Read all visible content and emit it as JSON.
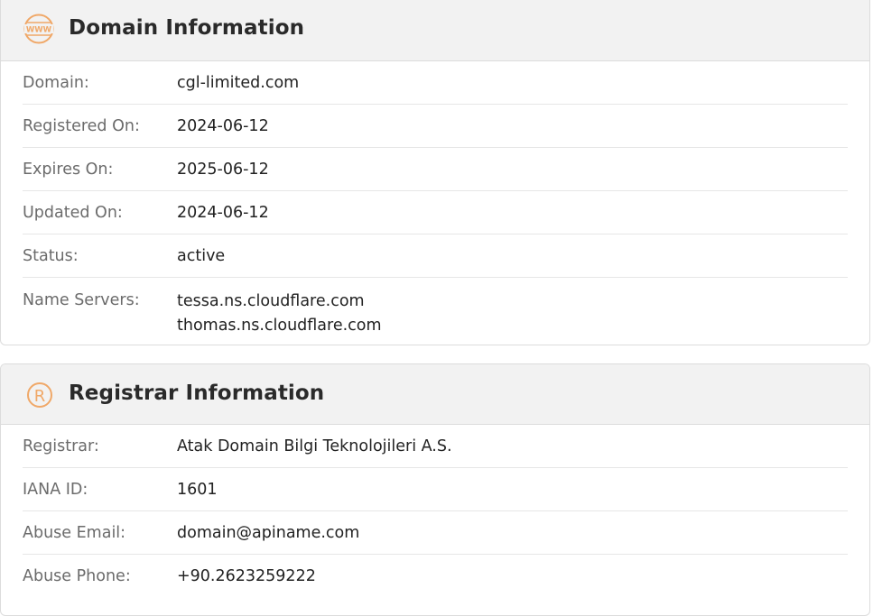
{
  "domain_section": {
    "title": "Domain Information",
    "icon": "www-icon",
    "accent": "#f0a868",
    "rows": [
      {
        "label": "Domain:",
        "value": "cgl-limited.com"
      },
      {
        "label": "Registered On:",
        "value": "2024-06-12"
      },
      {
        "label": "Expires On:",
        "value": "2025-06-12"
      },
      {
        "label": "Updated On:",
        "value": "2024-06-12"
      },
      {
        "label": "Status:",
        "value": "active"
      }
    ],
    "name_servers": {
      "label": "Name Servers:",
      "values": [
        "tessa.ns.cloudflare.com",
        "thomas.ns.cloudflare.com"
      ]
    }
  },
  "registrar_section": {
    "title": "Registrar Information",
    "icon": "registered-icon",
    "rows": [
      {
        "label": "Registrar:",
        "value": "Atak Domain Bilgi Teknolojileri A.S."
      },
      {
        "label": "IANA ID:",
        "value": "1601"
      },
      {
        "label": "Abuse Email:",
        "value": "domain@apiname.com"
      },
      {
        "label": "Abuse Phone:",
        "value": "+90.2623259222"
      }
    ]
  }
}
